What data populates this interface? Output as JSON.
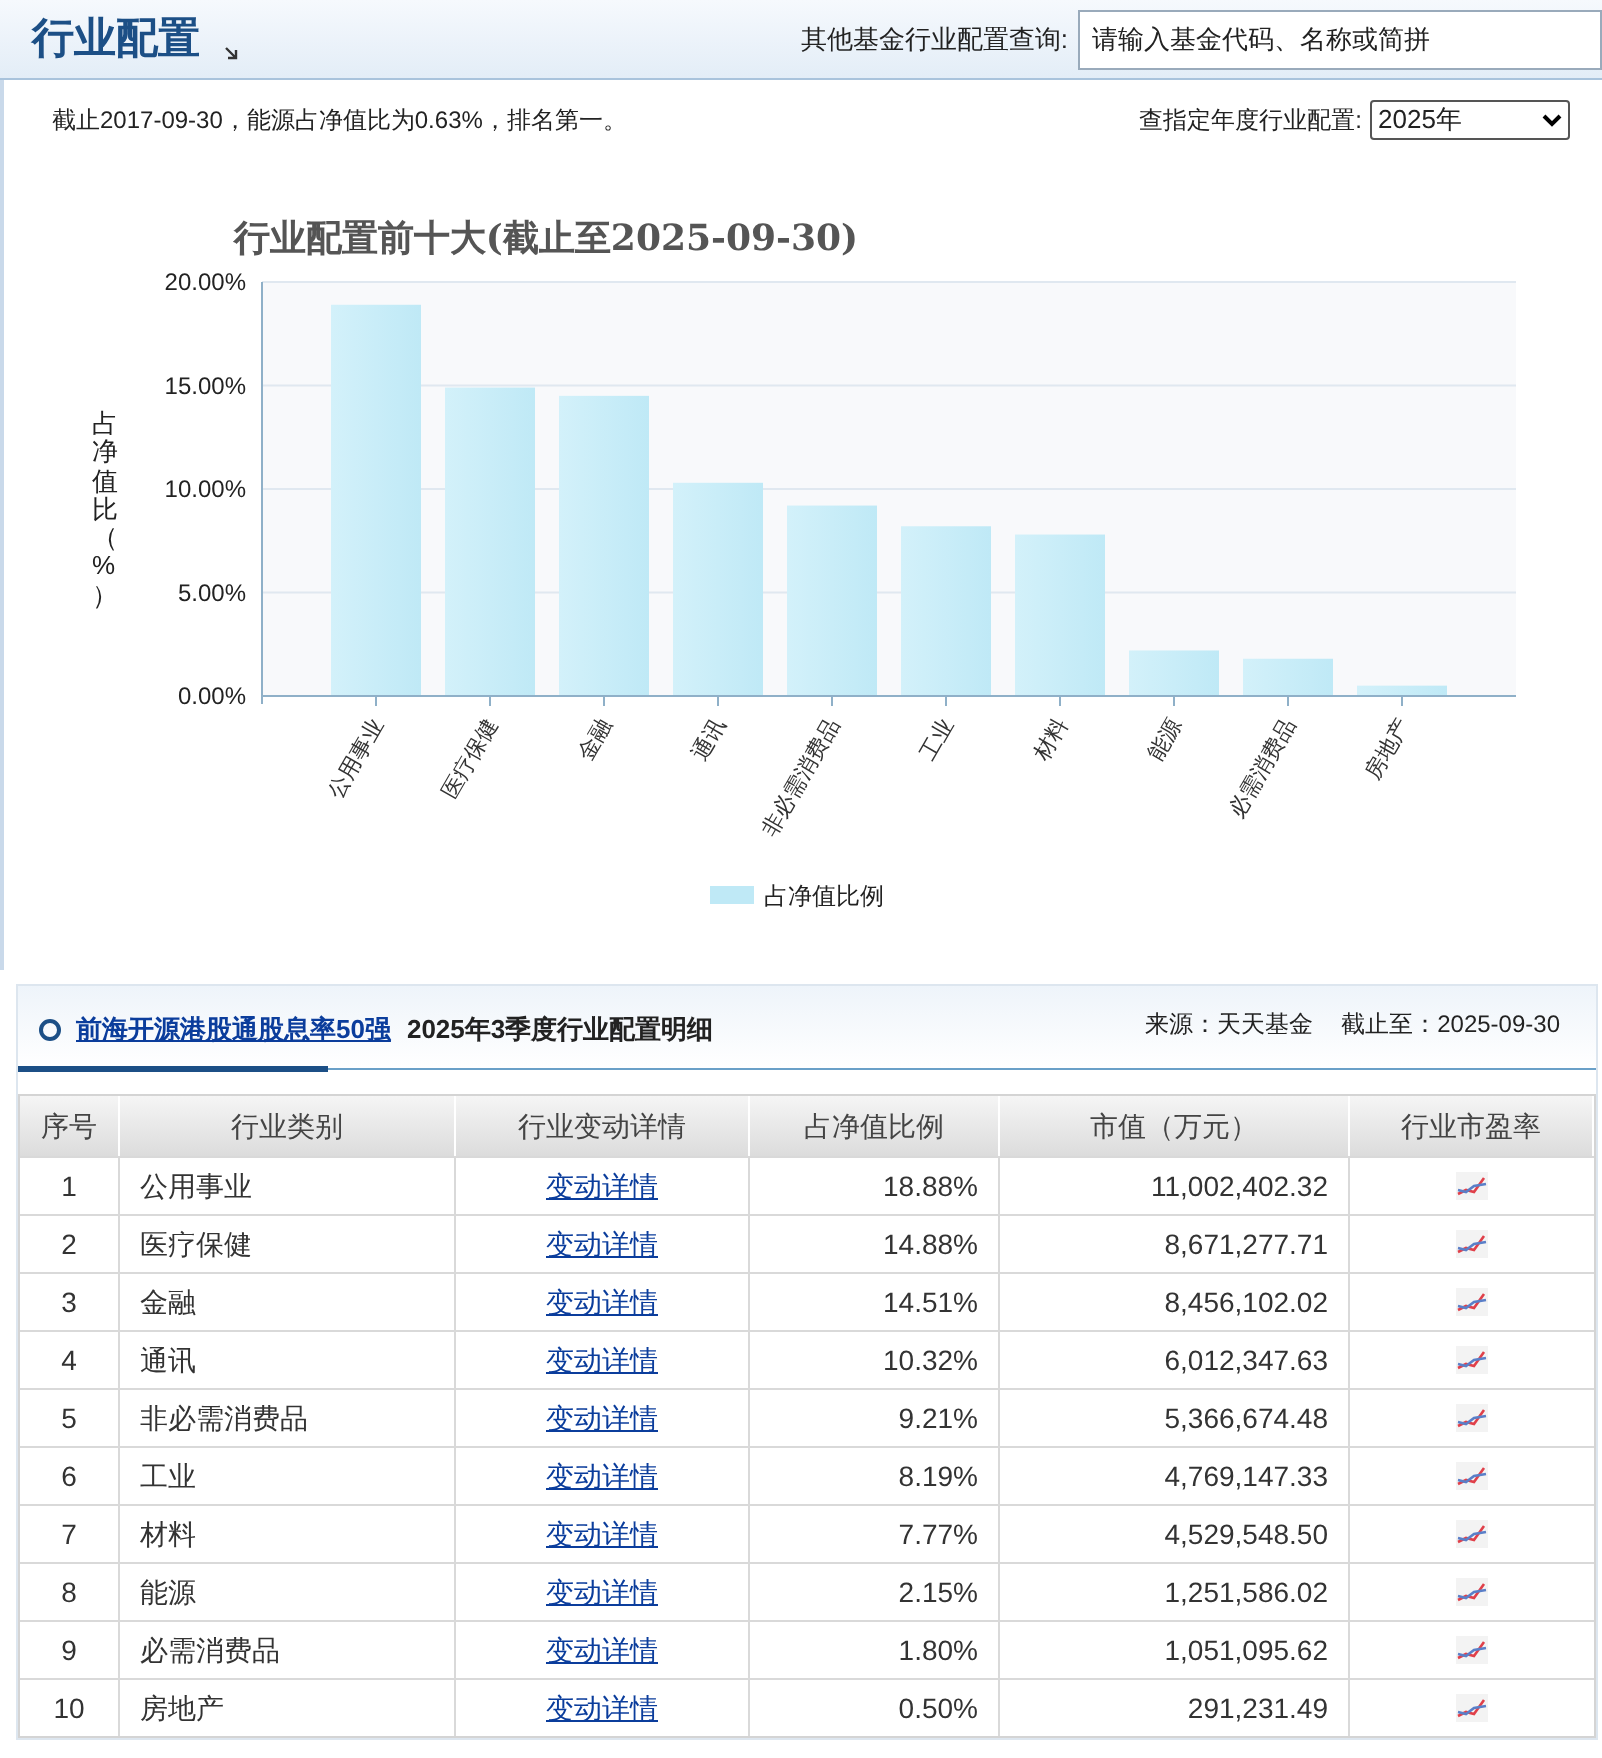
{
  "header": {
    "title": "行业配置",
    "search_label": "其他基金行业配置查询:",
    "search_placeholder": "请输入基金代码、名称或简拼"
  },
  "info": {
    "text": "截止2017-09-30，能源占净值比为0.63%，排名第一。",
    "year_label": "查指定年度行业配置:",
    "year_value": "2025年"
  },
  "chart": {
    "chart_data": {
      "type": "bar",
      "grid": true,
      "title": "行业配置前十大(截止至2025-09-30)",
      "ylabel": "占净值比（%）",
      "categories": [
        "公用事业",
        "医疗保健",
        "金融",
        "通讯",
        "非必需消费品",
        "工业",
        "材料",
        "能源",
        "必需消费品",
        "房地产"
      ],
      "series": [
        {
          "name": "占净值比例",
          "color": "#bfe9f6",
          "values": [
            18.9,
            14.9,
            14.5,
            10.3,
            9.2,
            8.2,
            7.8,
            2.2,
            1.8,
            0.5
          ]
        }
      ],
      "ylim": [
        0,
        20
      ],
      "yticks": [
        {
          "value": 0,
          "label": "0.00%"
        },
        {
          "value": 5,
          "label": "5.00%"
        },
        {
          "value": 10,
          "label": "10.00%"
        },
        {
          "value": 15,
          "label": "15.00%"
        },
        {
          "value": 20,
          "label": "20.00%"
        }
      ]
    }
  },
  "detail": {
    "fund_link": "前海开源港股通股息率50强",
    "title": "2025年3季度行业配置明细",
    "source": "来源：天天基金",
    "as_of": "截止至：2025-09-30",
    "columns": [
      "序号",
      "行业类别",
      "行业变动详情",
      "占净值比例",
      "市值（万元）",
      "行业市盈率"
    ],
    "rows": [
      {
        "no": "1",
        "industry": "公用事业",
        "link": "变动详情",
        "ratio": "18.88%",
        "value": "11,002,402.32"
      },
      {
        "no": "2",
        "industry": "医疗保健",
        "link": "变动详情",
        "ratio": "14.88%",
        "value": "8,671,277.71"
      },
      {
        "no": "3",
        "industry": "金融",
        "link": "变动详情",
        "ratio": "14.51%",
        "value": "8,456,102.02"
      },
      {
        "no": "4",
        "industry": "通讯",
        "link": "变动详情",
        "ratio": "10.32%",
        "value": "6,012,347.63"
      },
      {
        "no": "5",
        "industry": "非必需消费品",
        "link": "变动详情",
        "ratio": "9.21%",
        "value": "5,366,674.48"
      },
      {
        "no": "6",
        "industry": "工业",
        "link": "变动详情",
        "ratio": "8.19%",
        "value": "4,769,147.33"
      },
      {
        "no": "7",
        "industry": "材料",
        "link": "变动详情",
        "ratio": "7.77%",
        "value": "4,529,548.50"
      },
      {
        "no": "8",
        "industry": "能源",
        "link": "变动详情",
        "ratio": "2.15%",
        "value": "1,251,586.02"
      },
      {
        "no": "9",
        "industry": "必需消费品",
        "link": "变动详情",
        "ratio": "1.80%",
        "value": "1,051,095.62"
      },
      {
        "no": "10",
        "industry": "房地产",
        "link": "变动详情",
        "ratio": "0.50%",
        "value": "291,231.49"
      }
    ]
  }
}
